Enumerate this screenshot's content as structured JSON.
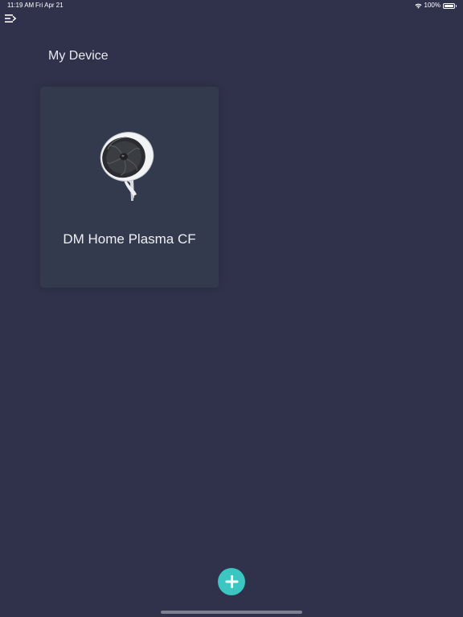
{
  "status_bar": {
    "time": "11:19 AM",
    "date": "Fri Apr 21",
    "battery_percent": "100%",
    "battery_level": 1.0,
    "wifi_icon": "wifi-icon",
    "battery_icon": "battery-icon"
  },
  "header": {
    "menu_icon": "menu-icon",
    "title": "My Device"
  },
  "devices": [
    {
      "name": "DM Home Plasma CF",
      "image_icon": "fan-icon"
    }
  ],
  "fab": {
    "icon": "plus-icon",
    "color": "#3cc6c2"
  },
  "colors": {
    "background": "#30314a",
    "card": "#343a4e",
    "accent": "#3cc6c2"
  }
}
